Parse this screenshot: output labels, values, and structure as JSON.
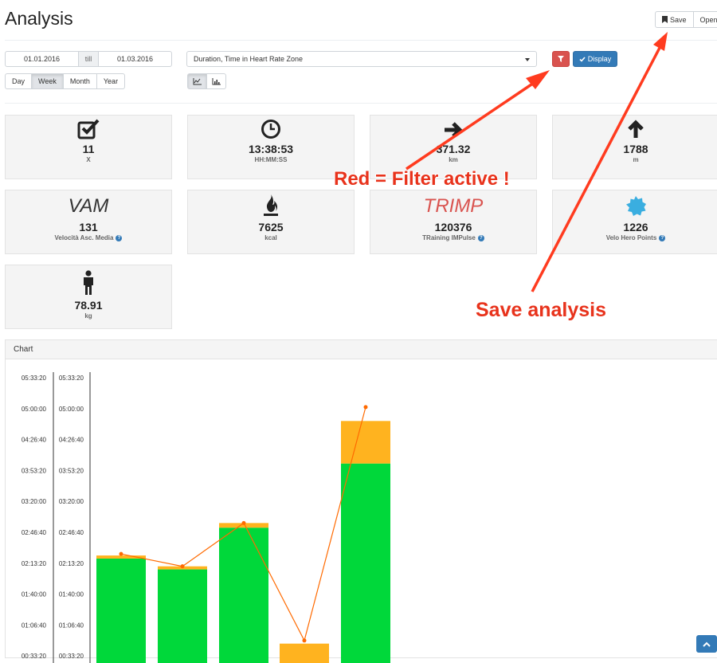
{
  "page": {
    "title": "Analysis"
  },
  "toolbar": {
    "save_label": "Save",
    "open_label": "Open"
  },
  "date_range": {
    "from": "01.01.2016",
    "till_label": "till",
    "to": "01.03.2016"
  },
  "granularity": {
    "options": [
      "Day",
      "Week",
      "Month",
      "Year"
    ],
    "active": "Week"
  },
  "chart_type_buttons": [
    "line-chart-icon",
    "bar-chart-icon"
  ],
  "metric_select": {
    "value": "Duration, Time in Heart Rate Zone"
  },
  "filter_button": {
    "icon": "filter-icon",
    "color": "#d9534f"
  },
  "display_button": {
    "label": "Display",
    "icon": "check-icon",
    "color": "#337ab7"
  },
  "stats": [
    {
      "icon": "checkbox-icon",
      "value": "11",
      "unit": "X",
      "help": false
    },
    {
      "icon": "clock-icon",
      "value": "13:38:53",
      "unit": "HH:MM:SS",
      "help": false
    },
    {
      "icon": "arrow-right-icon",
      "value": "371.32",
      "unit": "km",
      "help": false
    },
    {
      "icon": "arrow-up-icon",
      "value": "1788",
      "unit": "m",
      "help": false
    },
    {
      "icon": "text",
      "word": "VAM",
      "word_color": "#333333",
      "value": "131",
      "unit": "Velocità Asc. Media",
      "help": true
    },
    {
      "icon": "flame-icon",
      "value": "7625",
      "unit": "kcal",
      "help": false
    },
    {
      "icon": "text",
      "word": "TRIMP",
      "word_color": "#d9534f",
      "value": "120376",
      "unit": "TRaining IMPulse",
      "help": true
    },
    {
      "icon": "badge-icon",
      "value": "1226",
      "unit": "Velo Hero Points",
      "help": true
    },
    {
      "icon": "person-icon",
      "value": "78.91",
      "unit": "kg",
      "help": false
    }
  ],
  "chart_panel": {
    "heading": "Chart"
  },
  "annotations": {
    "filter_note": "Red = Filter active !",
    "save_note": "Save analysis",
    "color": "#e8331c"
  },
  "chart_data": {
    "type": "bar",
    "stacked": true,
    "y_ticks": [
      "05:33:20",
      "05:00:00",
      "04:26:40",
      "03:53:20",
      "03:20:00",
      "02:46:40",
      "02:13:20",
      "01:40:00",
      "01:06:40",
      "00:33:20"
    ],
    "ylim_seconds": [
      0,
      20000
    ],
    "categories": [
      "",
      "",
      "",
      "",
      ""
    ],
    "series": [
      {
        "color": "#6a2ed8",
        "values": [
          0,
          0,
          0,
          0,
          1350
        ]
      },
      {
        "color": "#00d83a",
        "values": [
          8300,
          7600,
          10300,
          600,
          13100
        ]
      },
      {
        "color": "#ffb31f",
        "values": [
          200,
          200,
          300,
          2200,
          2750
        ]
      }
    ],
    "line": {
      "color": "#ff6a00",
      "values": [
        8600,
        7800,
        10600,
        3000,
        18100
      ]
    }
  }
}
